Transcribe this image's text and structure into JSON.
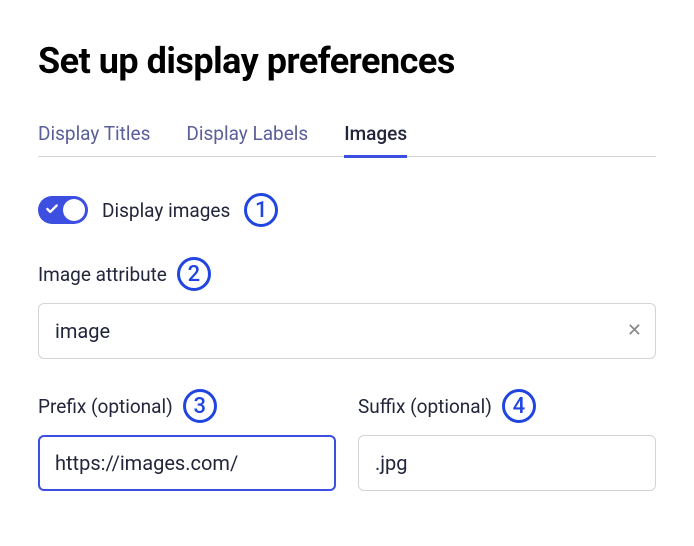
{
  "title": "Set up display preferences",
  "tabs": [
    {
      "label": "Display Titles",
      "active": false
    },
    {
      "label": "Display Labels",
      "active": false
    },
    {
      "label": "Images",
      "active": true
    }
  ],
  "toggle": {
    "label": "Display images",
    "on": true
  },
  "image_attribute": {
    "label": "Image attribute",
    "value": "image"
  },
  "prefix": {
    "label": "Prefix (optional)",
    "value": "https://images.com/"
  },
  "suffix": {
    "label": "Suffix (optional)",
    "value": ".jpg"
  },
  "annotations": {
    "a1": "1",
    "a2": "2",
    "a3": "3",
    "a4": "4"
  }
}
